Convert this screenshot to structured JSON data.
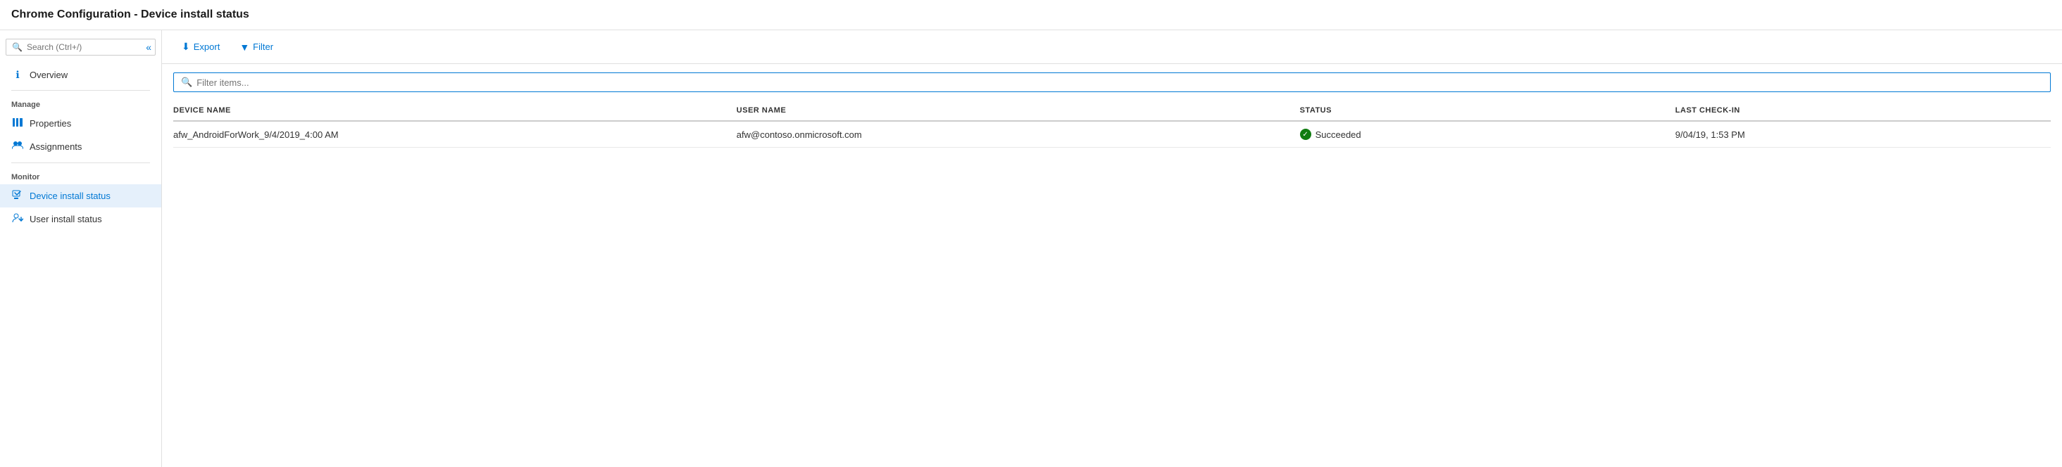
{
  "title": "Chrome Configuration - Device install status",
  "sidebar": {
    "search_placeholder": "Search (Ctrl+/)",
    "sections": [
      {
        "items": [
          {
            "id": "overview",
            "label": "Overview",
            "icon": "info-circle-icon",
            "active": false
          }
        ]
      },
      {
        "label": "Manage",
        "items": [
          {
            "id": "properties",
            "label": "Properties",
            "icon": "properties-icon",
            "active": false
          },
          {
            "id": "assignments",
            "label": "Assignments",
            "icon": "assignments-icon",
            "active": false
          }
        ]
      },
      {
        "label": "Monitor",
        "items": [
          {
            "id": "device-install-status",
            "label": "Device install status",
            "icon": "device-install-icon",
            "active": true
          },
          {
            "id": "user-install-status",
            "label": "User install status",
            "icon": "user-install-icon",
            "active": false
          }
        ]
      }
    ]
  },
  "toolbar": {
    "export_label": "Export",
    "filter_label": "Filter"
  },
  "filter": {
    "placeholder": "Filter items..."
  },
  "table": {
    "columns": [
      {
        "id": "device-name",
        "label": "DEVICE NAME"
      },
      {
        "id": "user-name",
        "label": "USER NAME"
      },
      {
        "id": "status",
        "label": "STATUS"
      },
      {
        "id": "last-checkin",
        "label": "LAST CHECK-IN"
      }
    ],
    "rows": [
      {
        "device_name": "afw_AndroidForWork_9/4/2019_4:00 AM",
        "user_name": "afw@contoso.onmicrosoft.com",
        "status": "Succeeded",
        "status_type": "success",
        "last_checkin": "9/04/19, 1:53 PM"
      }
    ]
  }
}
